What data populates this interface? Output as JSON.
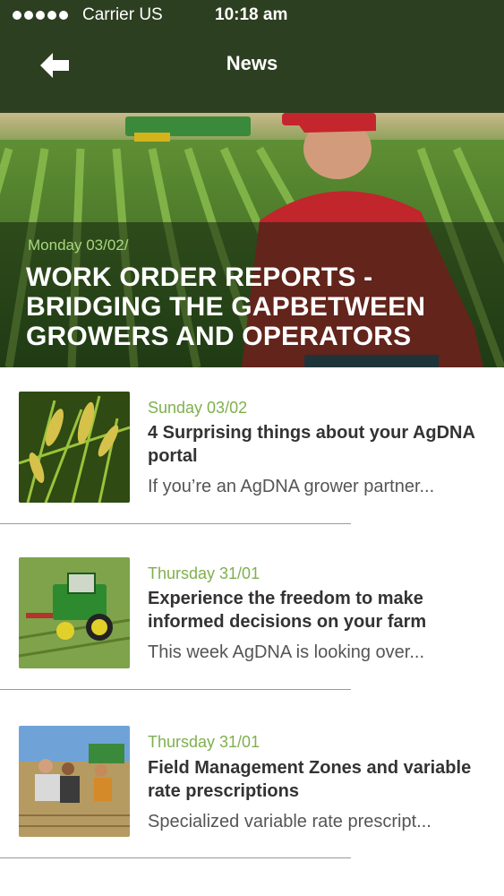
{
  "status_bar": {
    "carrier": "Carrier US",
    "time": "10:18 am",
    "signal_icon": "signal-dots-icon"
  },
  "nav": {
    "title": "News",
    "back_icon": "back-arrow-icon"
  },
  "featured": {
    "date": "Monday 03/02/",
    "headline": "WORK ORDER REPORTS - BRIDGING THE GAPBETWEEN GROWERS AND OPERATORS"
  },
  "articles": [
    {
      "date": "Sunday 03/02",
      "title": "4 Surprising things about your AgDNA portal",
      "excerpt": "If you’re an AgDNA grower partner..."
    },
    {
      "date": "Thursday 31/01",
      "title": "Experience the freedom to make informed decisions on your farm",
      "excerpt": "This week AgDNA is looking over..."
    },
    {
      "date": "Thursday 31/01",
      "title": "Field Management Zones and variable rate prescriptions",
      "excerpt": "Specialized variable rate prescript..."
    }
  ],
  "colors": {
    "header_bg": "#2d3f21",
    "accent_green": "#7fb04e",
    "text_dark": "#333333"
  }
}
